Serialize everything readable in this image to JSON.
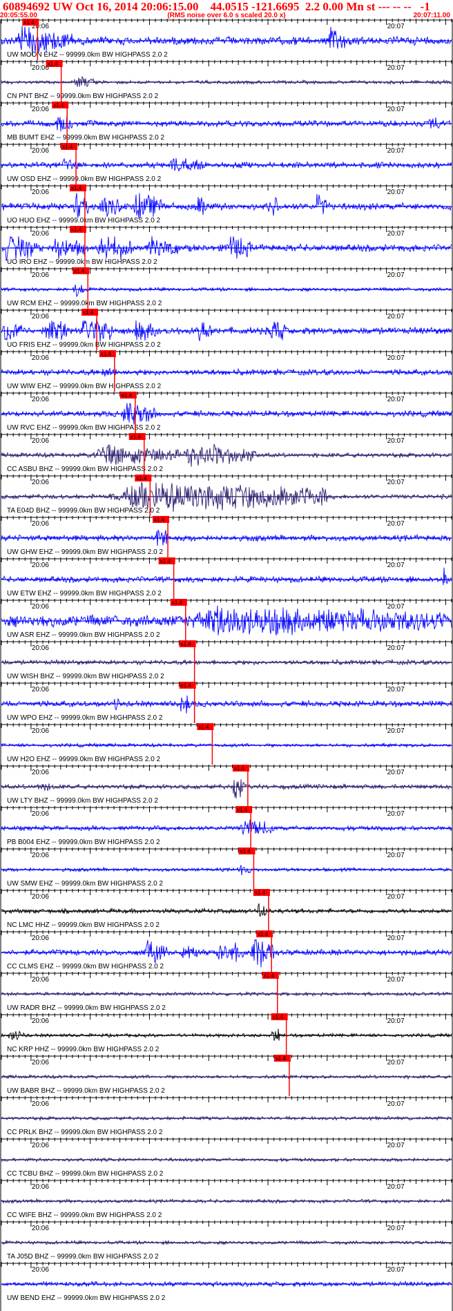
{
  "header": {
    "title": "60894692 UW Oct 16, 2014 20:06:15.00    44.0515 -121.6695  2.2 0.00 Mn st --- -- --   -1",
    "start_time": "20:05:55.00",
    "note": "(RMS noise over 6.0 s scaled 20.0 x)",
    "end_time": "20:07:11.00"
  },
  "colors": {
    "trace": "#0000ff",
    "trace_dark": "#2b1a6e",
    "trace_black": "#000000",
    "pick": "#ff0000",
    "axis": "#000000",
    "label": "#000000",
    "header": "#ff0000"
  },
  "chart_data": {
    "type": "line",
    "x_unit": "time",
    "tick_minute_labels": [
      "20:06",
      "20:07"
    ],
    "pick_label": "x1.4",
    "traces": [
      {
        "label": "UW MOON EHZ -- 99999.0km BW  HIGHPASS  2.0  2",
        "color": "blue",
        "amp": 0.35,
        "pick_time": 4.0,
        "env": [
          [
            2,
            12,
            1.0
          ],
          [
            55,
            58,
            0.9
          ]
        ]
      },
      {
        "label": "CN PNT BHZ -- 99999.0km BW  HIGHPASS  2.0  2",
        "color": "dark",
        "amp": 0.15,
        "pick_time": 8.0,
        "env": [
          [
            12,
            16,
            0.45
          ]
        ]
      },
      {
        "label": "MB BUMT EHZ -- 99999.0km BW  HIGHPASS  2.0  2",
        "color": "blue",
        "amp": 0.25,
        "pick_time": 9.0,
        "env": [
          [
            9,
            12,
            0.9
          ],
          [
            72,
            74,
            0.5
          ]
        ]
      },
      {
        "label": "UW OSD EHZ -- 99999.0km BW  HIGHPASS  2.0  2",
        "color": "blue",
        "amp": 0.25,
        "pick_time": 10.5,
        "env": [
          [
            10,
            13,
            0.5
          ],
          [
            28,
            34,
            0.55
          ]
        ]
      },
      {
        "label": "UO HUO EHZ -- 99999.0km BW  HIGHPASS  2.0  2",
        "color": "blue",
        "amp": 0.3,
        "pick_time": 12.0,
        "env": [
          [
            12,
            15,
            0.95
          ],
          [
            16,
            20,
            0.8
          ],
          [
            22,
            27,
            0.9
          ],
          [
            33,
            35,
            0.85
          ],
          [
            45,
            47,
            0.85
          ],
          [
            53,
            55,
            0.9
          ]
        ]
      },
      {
        "label": "UO IRO EHZ -- 99999.0km BW  HIGHPASS  2.0  2",
        "color": "blue",
        "amp": 0.3,
        "pick_time": 12.0,
        "env": [
          [
            0,
            6,
            0.9
          ],
          [
            8,
            14,
            0.8
          ],
          [
            16,
            22,
            0.95
          ],
          [
            24,
            30,
            0.7
          ],
          [
            38,
            42,
            0.85
          ]
        ]
      },
      {
        "label": "UW RCM EHZ -- 99999.0km BW  HIGHPASS  2.0  2",
        "color": "blue",
        "amp": 0.15,
        "pick_time": 12.5,
        "env": [
          [
            12,
            14,
            0.6
          ]
        ]
      },
      {
        "label": "UO FRIS EHZ -- 99999.0km BW  HIGHPASS  2.0  2",
        "color": "blue",
        "amp": 0.3,
        "pick_time": 14.0,
        "env": [
          [
            0,
            4,
            0.85
          ],
          [
            7,
            11,
            0.9
          ],
          [
            13,
            19,
            1.0
          ],
          [
            22,
            27,
            0.7
          ],
          [
            33,
            36,
            0.8
          ],
          [
            45,
            48,
            0.85
          ]
        ]
      },
      {
        "label": "UW WIW EHZ -- 99999.0km BW  HIGHPASS  2.0  2",
        "color": "blue",
        "amp": 0.25,
        "pick_time": 17.0,
        "env": [
          [
            17,
            19,
            0.7
          ]
        ]
      },
      {
        "label": "UW RVC EHZ -- 99999.0km BW  HIGHPASS  2.0  2",
        "color": "blue",
        "amp": 0.25,
        "pick_time": 20.5,
        "env": [
          [
            20,
            26,
            0.8
          ]
        ]
      },
      {
        "label": "CC ASBU BHZ -- 99999.0km BW  HIGHPASS  2.0  2",
        "color": "dark",
        "amp": 0.2,
        "pick_time": 22.0,
        "env": [
          [
            15,
            30,
            0.7
          ],
          [
            30,
            43,
            0.75
          ]
        ]
      },
      {
        "label": "TA E04D BHZ -- 99999.0km BW  HIGHPASS  2.0  2",
        "color": "dark",
        "amp": 0.2,
        "pick_time": 23.0,
        "env": [
          [
            18,
            55,
            1.0
          ]
        ]
      },
      {
        "label": "UW GHW EHZ -- 99999.0km BW  HIGHPASS  2.0  2",
        "color": "blue",
        "amp": 0.25,
        "pick_time": 26.0,
        "env": [
          [
            26,
            28,
            0.9
          ]
        ]
      },
      {
        "label": "UW ETW EHZ -- 99999.0km BW  HIGHPASS  2.0  2",
        "color": "blue",
        "amp": 0.25,
        "pick_time": 27.0,
        "env": [
          [
            74.5,
            75.5,
            1.0
          ]
        ]
      },
      {
        "label": "UW ASR EHZ -- 99999.0km BW  HIGHPASS  2.0  2",
        "color": "blue",
        "amp": 0.5,
        "pick_time": 29.0,
        "env": [
          [
            29,
            76,
            1.0
          ]
        ]
      },
      {
        "label": "UW WISH BHZ -- 99999.0km BW  HIGHPASS  2.0  2",
        "color": "dark",
        "amp": 0.2,
        "pick_time": 30.5,
        "env": []
      },
      {
        "label": "UW WPO EHZ -- 99999.0km BW  HIGHPASS  2.0  2",
        "color": "blue",
        "amp": 0.25,
        "pick_time": 30.5,
        "env": [
          [
            30,
            32,
            0.8
          ],
          [
            19,
            20,
            0.5
          ]
        ]
      },
      {
        "label": "UW H2O EHZ -- 99999.0km BW  HIGHPASS  2.0  2",
        "color": "blue",
        "amp": 0.15,
        "pick_time": 33.5,
        "env": []
      },
      {
        "label": "UW LTY BHZ -- 99999.0km BW  HIGHPASS  2.0  2",
        "color": "dark",
        "amp": 0.2,
        "pick_time": 39.5,
        "env": [
          [
            39,
            41,
            0.95
          ],
          [
            6,
            9,
            0.4
          ]
        ]
      },
      {
        "label": "PB B004 EHZ -- 99999.0km BW  HIGHPASS  2.0  2",
        "color": "blue",
        "amp": 0.2,
        "pick_time": 40.0,
        "env": [
          [
            40,
            46,
            0.6
          ]
        ]
      },
      {
        "label": "UW SMW EHZ -- 99999.0km BW  HIGHPASS  2.0  2",
        "color": "blue",
        "amp": 0.15,
        "pick_time": 40.5,
        "env": [
          [
            40,
            42,
            0.5
          ]
        ]
      },
      {
        "label": "NC LMC HHZ -- 99999.0km BW  HIGHPASS  2.0  2",
        "color": "black",
        "amp": 0.2,
        "pick_time": 43.0,
        "env": [
          [
            43,
            45,
            0.6
          ]
        ]
      },
      {
        "label": "CC CLMS EHZ -- 99999.0km BW  HIGHPASS  2.0  2",
        "color": "blue",
        "amp": 0.25,
        "pick_time": 43.5,
        "env": [
          [
            24,
            28,
            0.8
          ],
          [
            30,
            33,
            0.6
          ],
          [
            36,
            41,
            0.8
          ],
          [
            42,
            46,
            1.0
          ]
        ]
      },
      {
        "label": "UW RADR BHZ -- 99999.0km BW  HIGHPASS  2.0  2",
        "color": "dark",
        "amp": 0.15,
        "pick_time": 44.5,
        "env": []
      },
      {
        "label": "NC KRP HHZ -- 99999.0km BW  HIGHPASS  2.0  2",
        "color": "black",
        "amp": 0.15,
        "pick_time": 46.0,
        "env": [
          [
            45.5,
            47,
            0.6
          ],
          [
            1,
            4,
            0.4
          ]
        ]
      },
      {
        "label": "UW BABR BHZ -- 99999.0km BW  HIGHPASS  2.0  2",
        "color": "dark",
        "amp": 0.15,
        "pick_time": 46.5,
        "env": []
      },
      {
        "label": "CC PRLK BHZ -- 99999.0km BW  HIGHPASS  2.0  2",
        "color": "dark",
        "amp": 0.15,
        "pick_time": null,
        "env": []
      },
      {
        "label": "CC TCBU BHZ -- 99999.0km BW  HIGHPASS  2.0  2",
        "color": "dark",
        "amp": 0.15,
        "pick_time": null,
        "env": []
      },
      {
        "label": "CC WIFE BHZ -- 99999.0km BW  HIGHPASS  2.0  2",
        "color": "dark",
        "amp": 0.15,
        "pick_time": null,
        "env": []
      },
      {
        "label": "TA J05D BHZ -- 99999.0km BW  HIGHPASS  2.0  2",
        "color": "dark",
        "amp": 0.15,
        "pick_time": null,
        "env": []
      },
      {
        "label": "UW BEND EHZ -- 99999.0km BW  HIGHPASS  2.0  2",
        "color": "blue",
        "amp": 0.2,
        "pick_time": null,
        "env": []
      }
    ]
  }
}
